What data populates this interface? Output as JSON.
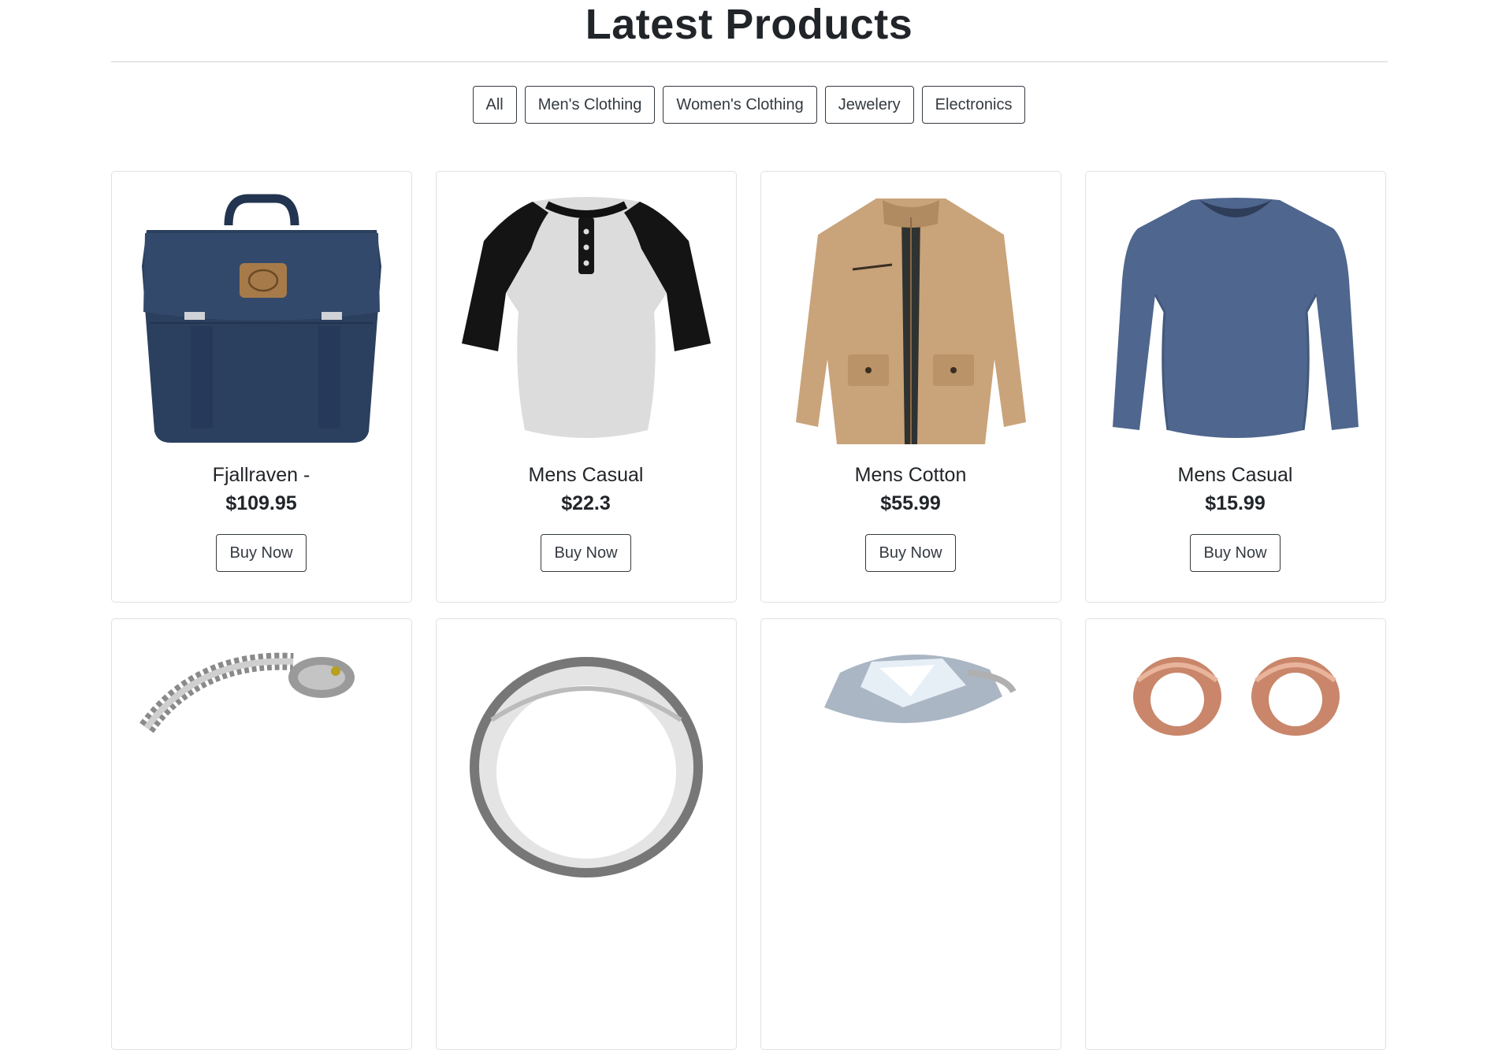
{
  "header": {
    "title": "Latest Products"
  },
  "filters": [
    "All",
    "Men's Clothing",
    "Women's Clothing",
    "Jewelery",
    "Electronics"
  ],
  "products": [
    {
      "title": "Fjallraven -",
      "price": "$109.95",
      "button": "Buy Now",
      "image": "backpack"
    },
    {
      "title": "Mens Casual",
      "price": "$22.3",
      "button": "Buy Now",
      "image": "raglan-tshirt"
    },
    {
      "title": "Mens Cotton",
      "price": "$55.99",
      "button": "Buy Now",
      "image": "jacket"
    },
    {
      "title": "Mens Casual",
      "price": "$15.99",
      "button": "Buy Now",
      "image": "long-sleeve-shirt"
    }
  ],
  "next_row": [
    {
      "image": "dragon-bracelet"
    },
    {
      "image": "silver-ring"
    },
    {
      "image": "diamond-ring"
    },
    {
      "image": "rose-gold-earrings"
    }
  ],
  "colors": {
    "text": "#212529",
    "border": "#343a40",
    "card_border": "#dee2e6"
  }
}
